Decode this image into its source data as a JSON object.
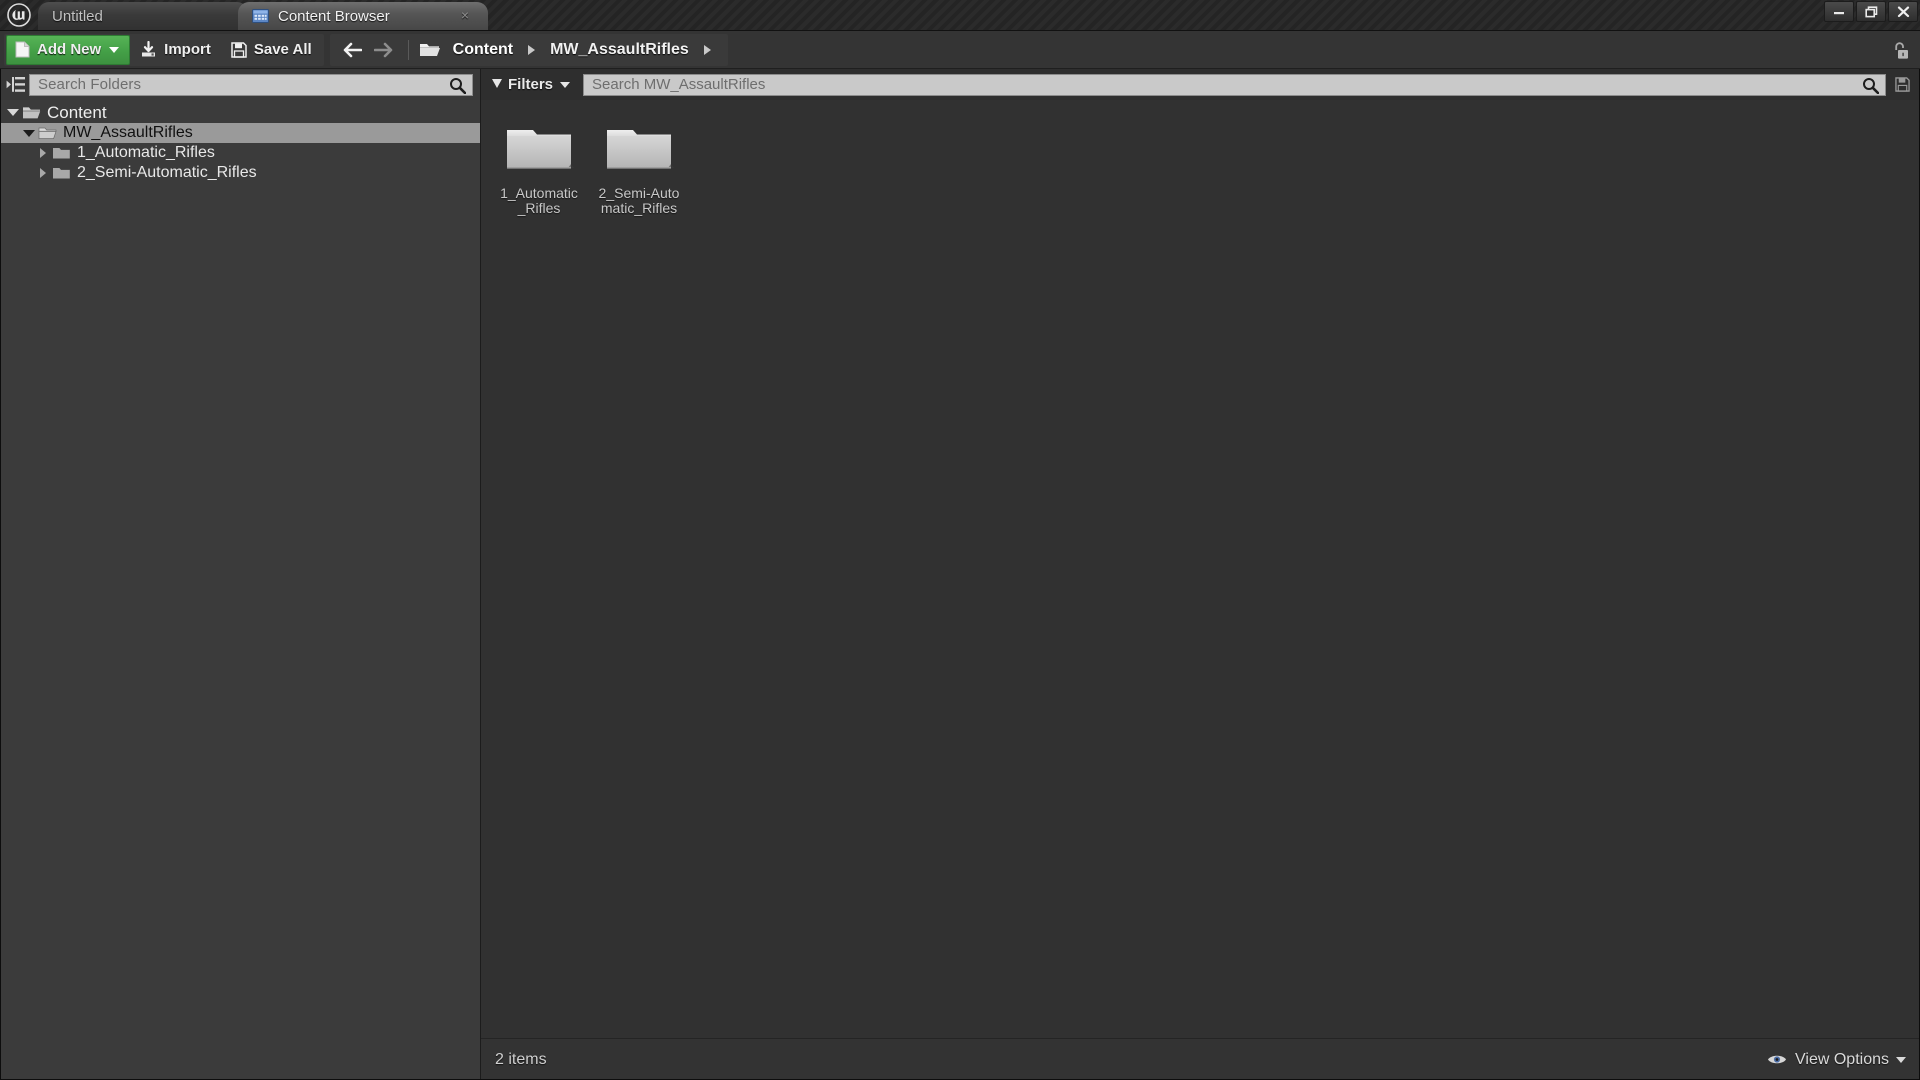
{
  "window": {
    "controls": {
      "minimize": "minimize-icon",
      "maximize": "restore-icon",
      "close": "close-icon"
    }
  },
  "titlebar": {
    "logo_icon": "unreal-engine-logo-icon",
    "tabs": [
      {
        "label": "Untitled",
        "active": false,
        "icon": null,
        "closable": false
      },
      {
        "label": "Content Browser",
        "active": true,
        "icon": "content-browser-icon",
        "closable": true,
        "close_glyph": "×"
      }
    ]
  },
  "toolbar": {
    "add_new_label": "Add New",
    "add_new_icon": "new-document-icon",
    "import_label": "Import",
    "import_icon": "import-download-icon",
    "save_all_label": "Save All",
    "save_all_icon": "floppy-disk-icon",
    "back_icon": "arrow-left-icon",
    "forward_icon": "arrow-right-icon",
    "folder_icon": "open-folder-icon",
    "breadcrumbs": [
      "Content",
      "MW_AssaultRifles"
    ],
    "lock_icon": "padlock-open-icon",
    "accent_green": "#44a047"
  },
  "sources": {
    "tree_toggle_icon": "collapse-tree-icon",
    "search": {
      "value": "",
      "placeholder": "Search Folders",
      "icon": "search-magnifier-icon"
    },
    "tree": [
      {
        "label": "Content",
        "depth": 0,
        "expanded": true,
        "selected": false,
        "has_children": true
      },
      {
        "label": "MW_AssaultRifles",
        "depth": 1,
        "expanded": true,
        "selected": true,
        "has_children": true
      },
      {
        "label": "1_Automatic_Rifles",
        "depth": 2,
        "expanded": false,
        "selected": false,
        "has_children": true
      },
      {
        "label": "2_Semi-Automatic_Rifles",
        "depth": 2,
        "expanded": false,
        "selected": false,
        "has_children": true
      }
    ]
  },
  "assets": {
    "filters_label": "Filters",
    "filters_icon": "funnel-filter-icon",
    "search": {
      "value": "",
      "placeholder": "Search MW_AssaultRifles",
      "icon": "search-magnifier-icon"
    },
    "save_search_icon": "floppy-disk-icon",
    "items": [
      {
        "name": "1_Automatic_Rifles",
        "type": "folder"
      },
      {
        "name": "2_Semi-Automatic_Rifles",
        "type": "folder"
      }
    ]
  },
  "status": {
    "item_count_label": "2 items",
    "view_options_label": "View Options",
    "view_options_icon": "eye-icon"
  }
}
